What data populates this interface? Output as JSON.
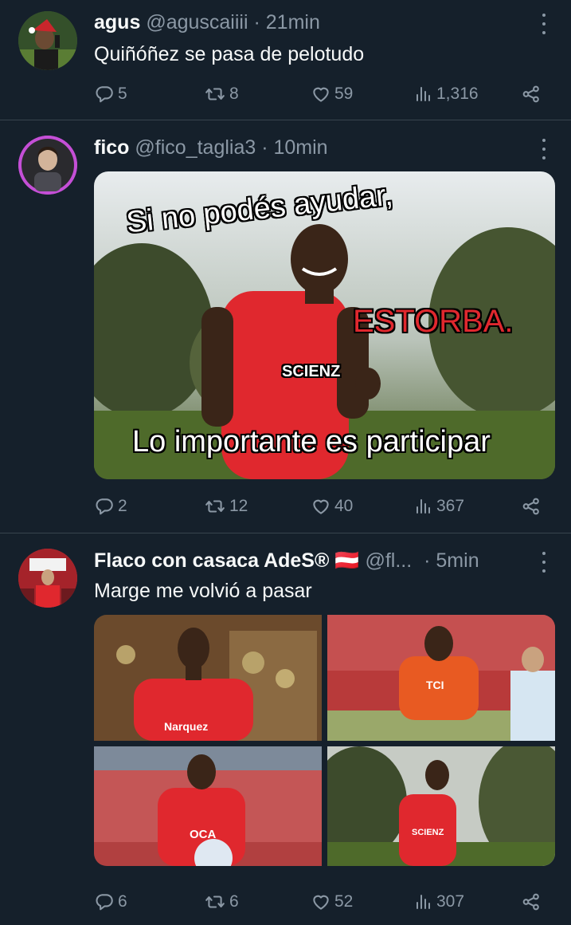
{
  "tweets": [
    {
      "name": "agus",
      "handle": "@aguscaiiii",
      "separator": "·",
      "time": "21min",
      "text": "Quiñóñez se pasa de pelotudo",
      "replies": "5",
      "retweets": "8",
      "likes": "59",
      "views": "1,316"
    },
    {
      "name": "fico",
      "handle": "@fico_taglia3",
      "separator": "·",
      "time": "10min",
      "text": "",
      "meme": {
        "top": "Si no podés ayudar,",
        "middle": "ESTORBA.",
        "bottom": "Lo importante es participar",
        "jersey_text": "SCIENZ"
      },
      "replies": "2",
      "retweets": "12",
      "likes": "40",
      "views": "367"
    },
    {
      "name": "Flaco con casaca AdeS®",
      "flag": "🇦🇹",
      "handle": "@fl...",
      "separator": "·",
      "time": "5min",
      "text": "Marge me volvió a pasar",
      "photos": [
        {
          "jersey_text": "Narquez"
        },
        {
          "jersey_text": "TCI"
        },
        {
          "jersey_text": "OCA"
        },
        {
          "jersey_text": "SCIENZ"
        }
      ],
      "replies": "6",
      "retweets": "6",
      "likes": "52",
      "views": "307"
    }
  ],
  "colors": {
    "background": "#15202b",
    "divider": "#38444d",
    "secondary_text": "#8b98a5",
    "primary_text": "#f7f9f9",
    "jersey_red": "#e0282e"
  },
  "icons": [
    "reply-icon",
    "retweet-icon",
    "like-icon",
    "views-icon",
    "share-icon",
    "more-icon"
  ]
}
